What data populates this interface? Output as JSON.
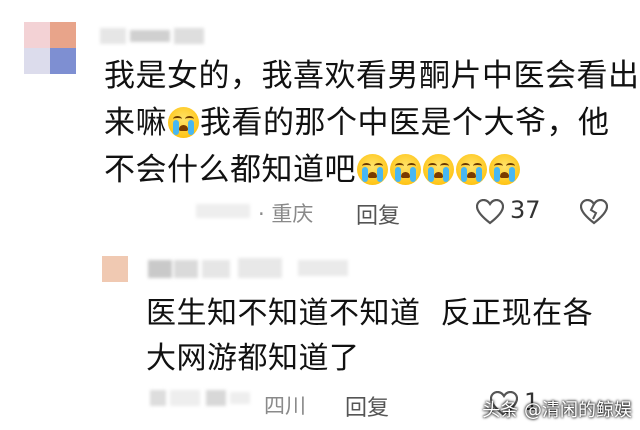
{
  "comment1": {
    "username": "",
    "lines": [
      "我是女的，我喜欢看男酮片中医会看出",
      "来嘛",
      "我看的那个中医是个大爷，他",
      "不会什么都知道吧"
    ],
    "location": "重庆",
    "reply_label": "回复",
    "like_count": "37"
  },
  "comment2": {
    "username": "",
    "lines": [
      "医生知不知道不知道  反正现在各",
      "大网游都知道了"
    ],
    "location": "四川",
    "reply_label": "回复",
    "like_count": "1"
  },
  "watermark": "头条 @清闲的鲸娱",
  "icons": {
    "crying": "loudly-crying-face-icon",
    "heart": "heart-icon",
    "broken_heart": "broken-heart-icon"
  }
}
